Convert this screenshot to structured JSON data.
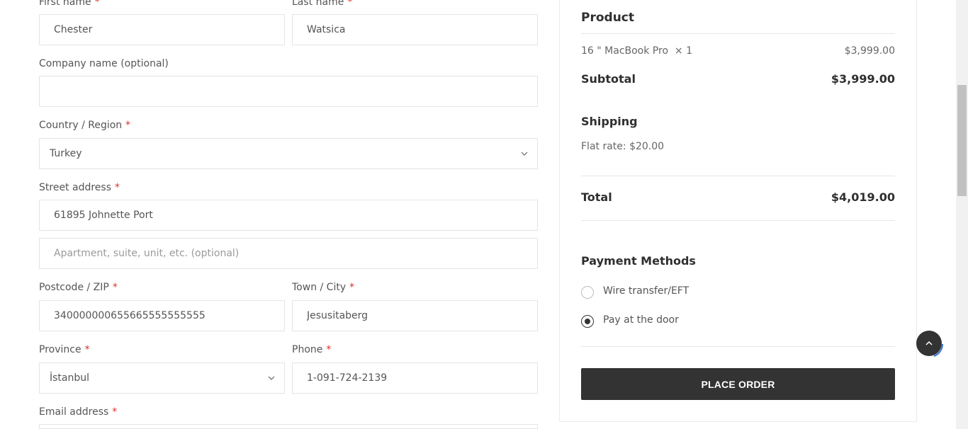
{
  "billing": {
    "first_name": {
      "label": "First name",
      "req": "*",
      "value": "Chester"
    },
    "last_name": {
      "label": "Last name",
      "req": "*",
      "value": "Watsica"
    },
    "company": {
      "label": "Company name (optional)",
      "value": ""
    },
    "country": {
      "label": "Country / Region",
      "req": "*",
      "selected": "Turkey"
    },
    "street": {
      "label": "Street address",
      "req": "*",
      "value": "61895 Johnette Port",
      "apt_placeholder": "Apartment, suite, unit, etc. (optional)"
    },
    "postcode": {
      "label": "Postcode / ZIP",
      "req": "*",
      "value": "340000000655665555555555"
    },
    "city": {
      "label": "Town / City",
      "req": "*",
      "value": "Jesusitaberg"
    },
    "province": {
      "label": "Province",
      "req": "*",
      "selected": "İstanbul"
    },
    "phone": {
      "label": "Phone",
      "req": "*",
      "value": "1-091-724-2139"
    },
    "email": {
      "label": "Email address",
      "req": "*"
    }
  },
  "summary": {
    "product_header": "Product",
    "item_name": "16 \" MacBook Pro",
    "item_qty": "× 1",
    "item_price": "$3,999.00",
    "subtotal_label": "Subtotal",
    "subtotal_value": "$3,999.00",
    "shipping_label": "Shipping",
    "shipping_rate": "Flat rate: $20.00",
    "total_label": "Total",
    "total_value": "$4,019.00",
    "payment_header": "Payment Methods",
    "payment_options": [
      "Wire transfer/EFT",
      "Pay at the door"
    ],
    "selected_payment": "Pay at the door",
    "place_order": "PLACE ORDER"
  },
  "icons": {
    "select_arrow": "chevron-down-icon",
    "back_to_top": "chevron-up-icon"
  },
  "colors": {
    "accent": "#333333",
    "required": "#d9302b",
    "progress_ring": "#2f6fd6"
  }
}
